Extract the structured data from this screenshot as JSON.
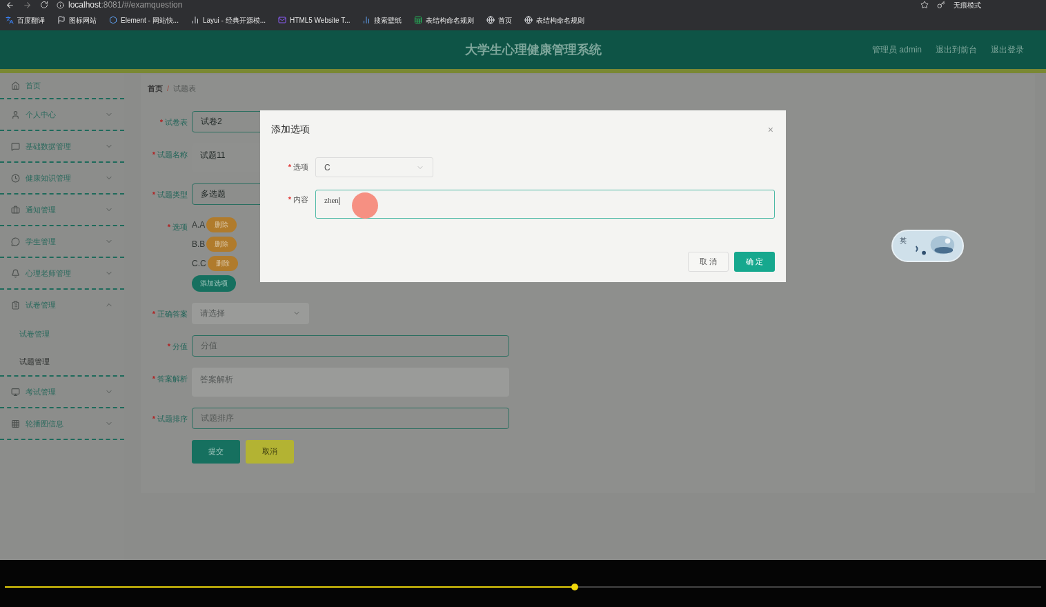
{
  "browser": {
    "host": "localhost",
    "path": ":8081/#/examquestion",
    "profile_label": "无痕模式",
    "bookmarks": [
      "百度翻译",
      "图标网站",
      "Element - 网站快...",
      "Layui - 经典开源模...",
      "HTML5 Website T...",
      "搜索壁纸",
      "表结构命名规则",
      "首页",
      "表结构命名规则"
    ]
  },
  "header": {
    "title": "大学生心理健康管理系统",
    "user": "管理员 admin",
    "links": [
      "退出到前台",
      "退出登录"
    ]
  },
  "sidebar": {
    "items": [
      {
        "label": "首页"
      },
      {
        "label": "个人中心",
        "expanded": false
      },
      {
        "label": "基础数据管理",
        "expanded": false
      },
      {
        "label": "健康知识管理",
        "expanded": false
      },
      {
        "label": "通知管理",
        "expanded": false
      },
      {
        "label": "学生管理",
        "expanded": false
      },
      {
        "label": "心理老师管理",
        "expanded": false
      },
      {
        "label": "试卷管理",
        "expanded": true,
        "children": [
          {
            "label": "试卷管理",
            "selected": false
          },
          {
            "label": "试题管理",
            "selected": true
          }
        ]
      },
      {
        "label": "考试管理",
        "expanded": false
      },
      {
        "label": "轮播图信息",
        "expanded": false
      }
    ]
  },
  "breadcrumb": {
    "items": [
      "首页",
      "试题表"
    ],
    "separator": "/"
  },
  "form": {
    "required_mark": "*",
    "rows": [
      {
        "kind": "input",
        "label": "试卷表",
        "value": "试卷2"
      },
      {
        "kind": "textarea",
        "label": "试题名称",
        "value": "试题11"
      },
      {
        "kind": "input",
        "label": "试题类型",
        "value": "多选题"
      },
      {
        "kind": "options",
        "label": "选项",
        "items": [
          {
            "text": "A.A",
            "action": "删除"
          },
          {
            "text": "B.B",
            "action": "删除"
          },
          {
            "text": "C.C",
            "action": "删除"
          }
        ],
        "add_button": "添加选项"
      },
      {
        "kind": "select",
        "label": "正确答案",
        "placeholder": "请选择",
        "disabled": true
      },
      {
        "kind": "input",
        "label": "分值",
        "placeholder": "分值"
      },
      {
        "kind": "textarea",
        "label": "答案解析",
        "placeholder": "答案解析",
        "disabled": true
      },
      {
        "kind": "input",
        "label": "试题排序",
        "placeholder": "试题排序"
      }
    ],
    "buttons": [
      {
        "label": "提交",
        "kind": "primary"
      },
      {
        "label": "取消",
        "kind": "warning"
      }
    ]
  },
  "modal": {
    "title": "添加选项",
    "close": "×",
    "required_mark": "*",
    "fields": [
      {
        "kind": "select",
        "label": "选项",
        "value": "C"
      },
      {
        "kind": "textarea",
        "label": "内容",
        "value": "zhen",
        "focused": true
      }
    ],
    "buttons": [
      {
        "label": "取 消",
        "kind": "default"
      },
      {
        "label": "确 定",
        "kind": "primary"
      }
    ]
  },
  "ime": {
    "label": "英"
  },
  "video": {
    "progress": {
      "level": 0.55
    }
  }
}
